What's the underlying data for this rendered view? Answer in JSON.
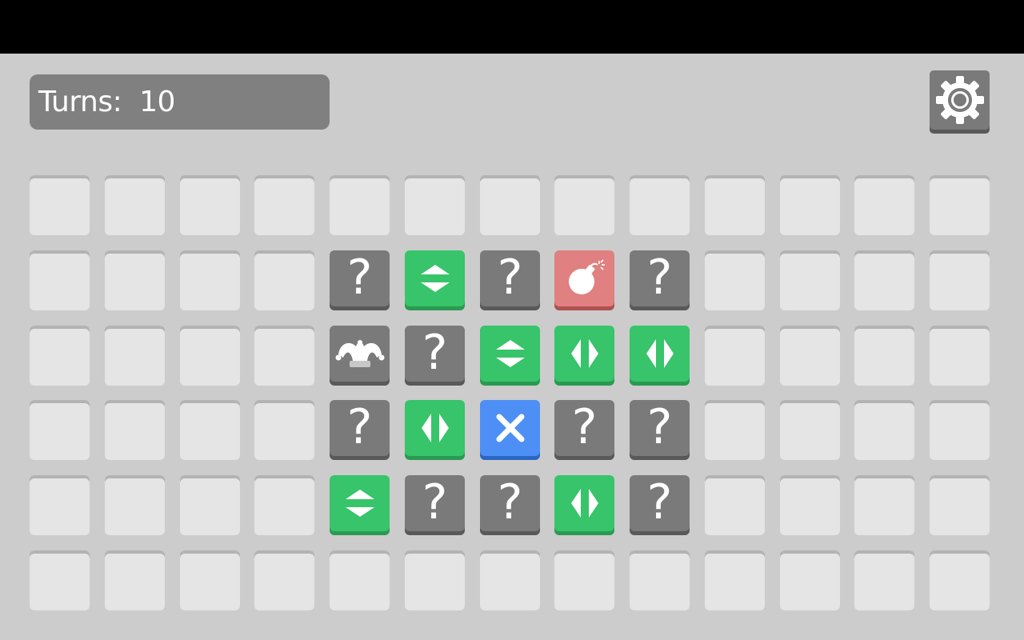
{
  "hud": {
    "turns_text": "Turns:  10",
    "settings_icon": "gear-icon"
  },
  "colors": {
    "background": "#cccccc",
    "empty_cell": "#e5e5e5",
    "question_tile": "#7a7a7a",
    "arrow_tile": "#37c46a",
    "bomb_tile": "#e08080",
    "target_tile": "#4d8ff5"
  },
  "board": {
    "columns": 13,
    "rows": 6,
    "question_glyph": "?",
    "tiles": [
      {
        "row": 1,
        "col": 4,
        "type": "question"
      },
      {
        "row": 1,
        "col": 5,
        "type": "vertical"
      },
      {
        "row": 1,
        "col": 6,
        "type": "question"
      },
      {
        "row": 1,
        "col": 7,
        "type": "bomb"
      },
      {
        "row": 1,
        "col": 8,
        "type": "question"
      },
      {
        "row": 2,
        "col": 4,
        "type": "jester"
      },
      {
        "row": 2,
        "col": 5,
        "type": "question"
      },
      {
        "row": 2,
        "col": 6,
        "type": "vertical"
      },
      {
        "row": 2,
        "col": 7,
        "type": "horizontal"
      },
      {
        "row": 2,
        "col": 8,
        "type": "horizontal"
      },
      {
        "row": 3,
        "col": 4,
        "type": "question"
      },
      {
        "row": 3,
        "col": 5,
        "type": "horizontal"
      },
      {
        "row": 3,
        "col": 6,
        "type": "target"
      },
      {
        "row": 3,
        "col": 7,
        "type": "question"
      },
      {
        "row": 3,
        "col": 8,
        "type": "question"
      },
      {
        "row": 4,
        "col": 4,
        "type": "vertical"
      },
      {
        "row": 4,
        "col": 5,
        "type": "question"
      },
      {
        "row": 4,
        "col": 6,
        "type": "question"
      },
      {
        "row": 4,
        "col": 7,
        "type": "horizontal"
      },
      {
        "row": 4,
        "col": 8,
        "type": "question"
      }
    ]
  }
}
